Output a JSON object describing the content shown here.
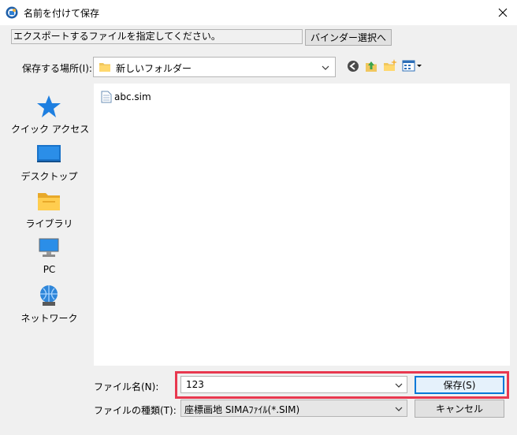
{
  "window": {
    "title": "名前を付けて保存",
    "close_icon": "close-icon"
  },
  "instruction": {
    "text": "エクスポートするファイルを指定してください。"
  },
  "binder_button": {
    "label": "バインダー選択へ"
  },
  "location": {
    "label": "保存する場所(I):",
    "value": "新しいフォルダー"
  },
  "toolbar_icons": [
    "back-icon",
    "up-folder-icon",
    "new-folder-icon",
    "view-menu-icon"
  ],
  "places": [
    {
      "label": "クイック アクセス",
      "icon": "quick-access-star-icon"
    },
    {
      "label": "デスクトップ",
      "icon": "desktop-icon"
    },
    {
      "label": "ライブラリ",
      "icon": "library-icon"
    },
    {
      "label": "PC",
      "icon": "pc-icon"
    },
    {
      "label": "ネットワーク",
      "icon": "network-icon"
    }
  ],
  "files": [
    {
      "name": "abc.sim",
      "icon": "file-icon"
    }
  ],
  "filename": {
    "label": "ファイル名(N):",
    "value": "123"
  },
  "filetype": {
    "label": "ファイルの種類(T):",
    "value": "座標画地 SIMAﾌｧｲﾙ(*.SIM)"
  },
  "buttons": {
    "save": "保存(S)",
    "cancel": "キャンセル"
  },
  "colors": {
    "highlight": "#e8384f",
    "accent": "#0078d7"
  }
}
